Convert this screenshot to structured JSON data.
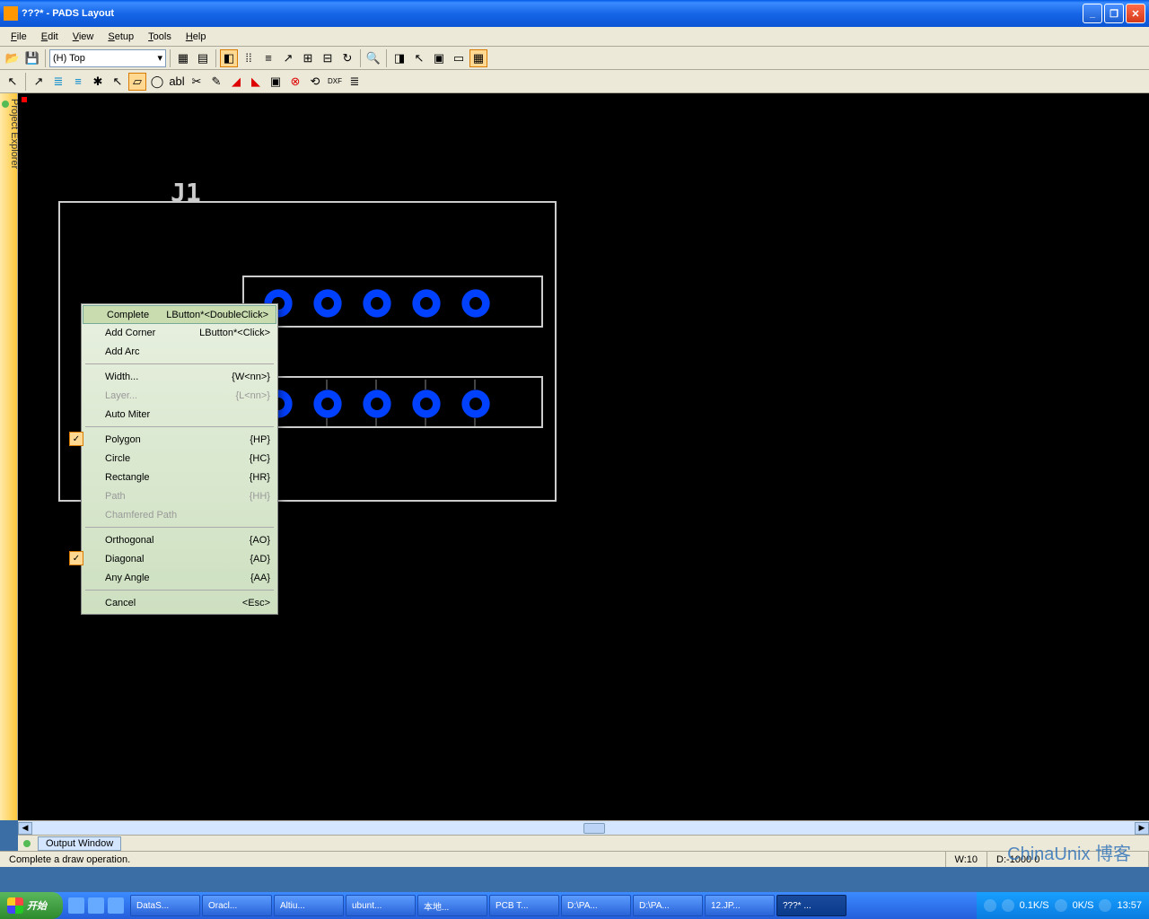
{
  "title": "???* - PADS Layout",
  "menus": {
    "file": "File",
    "edit": "Edit",
    "view": "View",
    "setup": "Setup",
    "tools": "Tools",
    "help": "Help"
  },
  "layer_select": "(H) Top",
  "sidebar_label": "Project Explorer",
  "component_label": "J1",
  "context_menu": {
    "complete": {
      "label": "Complete",
      "sc": "LButton*<DoubleClick>"
    },
    "add_corner": {
      "label": "Add Corner",
      "sc": "LButton*<Click>"
    },
    "add_arc": {
      "label": "Add Arc"
    },
    "width": {
      "label": "Width...",
      "sc": "{W<nn>}"
    },
    "layer": {
      "label": "Layer...",
      "sc": "{L<nn>}"
    },
    "auto_miter": {
      "label": "Auto Miter"
    },
    "polygon": {
      "label": "Polygon",
      "sc": "{HP}"
    },
    "circle": {
      "label": "Circle",
      "sc": "{HC}"
    },
    "rectangle": {
      "label": "Rectangle",
      "sc": "{HR}"
    },
    "path": {
      "label": "Path",
      "sc": "{HH}"
    },
    "chamfered": {
      "label": "Chamfered Path"
    },
    "orthogonal": {
      "label": "Orthogonal",
      "sc": "{AO}"
    },
    "diagonal": {
      "label": "Diagonal",
      "sc": "{AD}"
    },
    "any_angle": {
      "label": "Any Angle",
      "sc": "{AA}"
    },
    "cancel": {
      "label": "Cancel",
      "sc": "<Esc>"
    }
  },
  "output_tab": "Output Window",
  "status": {
    "msg": "Complete a draw operation.",
    "w": "W:10",
    "d": "D:-1000  0"
  },
  "watermark": "ChinaUnix 博客",
  "taskbar": {
    "start": "开始",
    "items": [
      "DataS...",
      "Oracl...",
      "Altiu...",
      "ubunt...",
      "本地...",
      "PCB T...",
      "D:\\PA...",
      "D:\\PA...",
      "12.JP...",
      "???* ..."
    ],
    "tray": {
      "net1": "0.1K/S",
      "net2": "0K/S",
      "time": "13:57"
    }
  }
}
